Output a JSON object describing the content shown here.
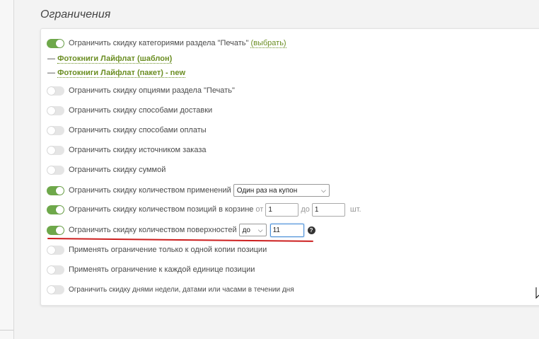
{
  "section": {
    "title": "Ограничения"
  },
  "rows": {
    "print_categories": {
      "label": "Ограничить скидку категориями раздела \"Печать\"",
      "pick_link": "(выбрать)",
      "enabled": true
    },
    "selected_categories": [
      {
        "dash": "—",
        "name": "Фотокниги Лайфлат (шаблон)"
      },
      {
        "dash": "—",
        "name": "Фотокниги Лайфлат (пакет) - new"
      }
    ],
    "print_options": {
      "label": "Ограничить скидку опциями раздела \"Печать\"",
      "enabled": false
    },
    "delivery": {
      "label": "Ограничить скидку способами доставки",
      "enabled": false
    },
    "payment": {
      "label": "Ограничить скидку способами оплаты",
      "enabled": false
    },
    "order_source": {
      "label": "Ограничить скидку источником заказа",
      "enabled": false
    },
    "amount": {
      "label": "Ограничить скидку суммой",
      "enabled": false
    },
    "usage_count": {
      "label": "Ограничить скидку количеством применений",
      "select_value": "Один раз на купон",
      "enabled": true
    },
    "cart_positions": {
      "label": "Ограничить скидку количеством позиций в корзине",
      "from_label": "от",
      "from_value": "1",
      "to_label": "до",
      "to_value": "1",
      "unit": "шт.",
      "enabled": true
    },
    "surfaces": {
      "label": "Ограничить скидку количеством поверхностей",
      "select_value": "до",
      "value": "11",
      "help": "?",
      "enabled": true
    },
    "one_copy": {
      "label": "Применять ограничение только к одной копии позиции",
      "enabled": false
    },
    "each_unit": {
      "label": "Применять ограничение к каждой единице позиции",
      "enabled": false
    },
    "schedule": {
      "label": "Ограничить скидку днями недели, датами или часами в течении дня",
      "enabled": false
    }
  },
  "colors": {
    "toggle_on": "#6ea84a",
    "toggle_off": "#e5e5e5",
    "link": "#6b8e23",
    "annotation": "#cc1f1f"
  },
  "icons": {
    "help": "question-circle-icon",
    "chevron": "chevron-down-icon"
  }
}
